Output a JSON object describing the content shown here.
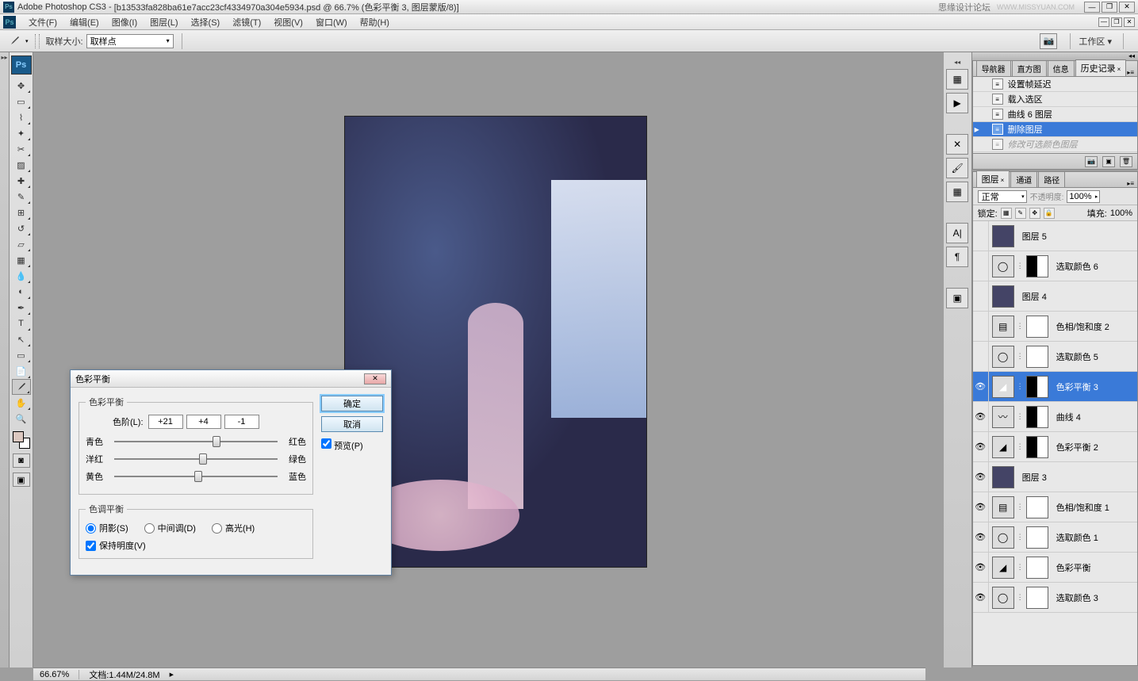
{
  "titlebar": {
    "app": "Adobe Photoshop CS3",
    "doc": "[b13533fa828ba61e7acc23cf4334970a304e5934.psd @ 66.7% (色彩平衡 3, 图层蒙版/8)]",
    "extra": "思缘设计论坛",
    "watermark": "WWW.MISSYUAN.COM"
  },
  "menubar": {
    "items": [
      "文件(F)",
      "编辑(E)",
      "图像(I)",
      "图层(L)",
      "选择(S)",
      "滤镜(T)",
      "视图(V)",
      "窗口(W)",
      "帮助(H)"
    ]
  },
  "optionsbar": {
    "sample_label": "取样大小:",
    "sample_value": "取样点",
    "workspace": "工作区 ▾"
  },
  "dialog": {
    "title": "色彩平衡",
    "group1": "色彩平衡",
    "levels_label": "色阶(L):",
    "levels": [
      "+21",
      "+4",
      "-1"
    ],
    "sliders": [
      {
        "left": "青色",
        "right": "红色",
        "pos": 60
      },
      {
        "left": "洋红",
        "right": "绿色",
        "pos": 52
      },
      {
        "left": "黄色",
        "right": "蓝色",
        "pos": 49
      }
    ],
    "group2": "色调平衡",
    "radios": {
      "shadows": "阴影(S)",
      "midtones": "中间调(D)",
      "highlights": "高光(H)"
    },
    "preserve": "保持明度(V)",
    "ok": "确定",
    "cancel": "取消",
    "preview": "预览(P)"
  },
  "history": {
    "tabs": [
      "导航器",
      "直方图",
      "信息",
      "历史记录"
    ],
    "items": [
      {
        "label": "设置帧延迟",
        "sel": false
      },
      {
        "label": "载入选区",
        "sel": false
      },
      {
        "label": "曲线 6 图层",
        "sel": false
      },
      {
        "label": "删除图层",
        "sel": true
      },
      {
        "label": "修改可选颜色图层",
        "dim": true
      }
    ]
  },
  "layers": {
    "tabs": [
      "图层",
      "通道",
      "路径"
    ],
    "blend": "正常",
    "opacity_label": "不透明度:",
    "opacity": "100%",
    "lock_label": "锁定:",
    "fill_label": "填充:",
    "fill": "100%",
    "items": [
      {
        "name": "图层 5",
        "eye": false,
        "thumbs": [
          "img"
        ]
      },
      {
        "name": "选取颜色 6",
        "eye": false,
        "thumbs": [
          "adj-sc",
          "link",
          "mask2"
        ]
      },
      {
        "name": "图层 4",
        "eye": false,
        "thumbs": [
          "img"
        ]
      },
      {
        "name": "色相/饱和度 2",
        "eye": false,
        "thumbs": [
          "adj-hs",
          "link",
          "mask"
        ]
      },
      {
        "name": "选取颜色 5",
        "eye": false,
        "thumbs": [
          "adj-sc",
          "link",
          "mask"
        ]
      },
      {
        "name": "色彩平衡 3",
        "eye": true,
        "sel": true,
        "thumbs": [
          "adj-cb",
          "link",
          "mask2"
        ]
      },
      {
        "name": "曲线 4",
        "eye": true,
        "thumbs": [
          "adj-cv",
          "link",
          "mask2"
        ]
      },
      {
        "name": "色彩平衡 2",
        "eye": true,
        "thumbs": [
          "adj-cb",
          "link",
          "mask2"
        ]
      },
      {
        "name": "图层 3",
        "eye": true,
        "thumbs": [
          "img"
        ]
      },
      {
        "name": "色相/饱和度 1",
        "eye": true,
        "thumbs": [
          "adj-hs",
          "link",
          "mask"
        ]
      },
      {
        "name": "选取颜色 1",
        "eye": true,
        "thumbs": [
          "adj-sc",
          "link",
          "mask"
        ]
      },
      {
        "name": "色彩平衡",
        "eye": true,
        "thumbs": [
          "adj-cb",
          "link",
          "mask"
        ]
      },
      {
        "name": "选取颜色 3",
        "eye": true,
        "thumbs": [
          "adj-sc",
          "link",
          "mask"
        ]
      }
    ]
  },
  "statusbar": {
    "zoom": "66.67%",
    "doc_info": "文档:1.44M/24.8M"
  }
}
